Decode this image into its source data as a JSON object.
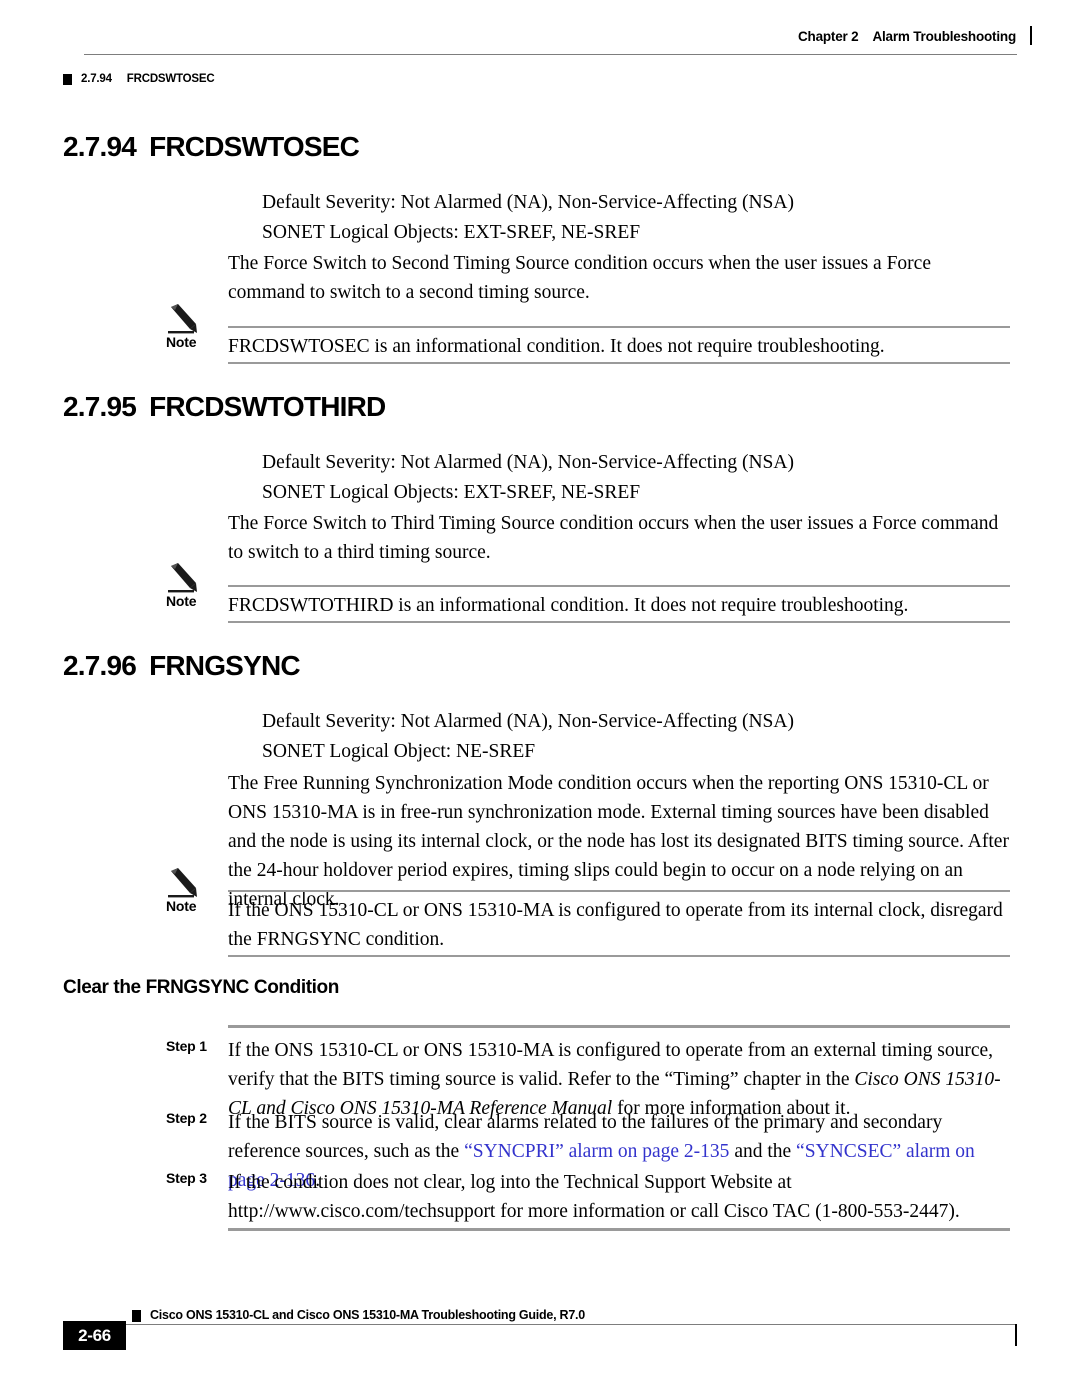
{
  "header": {
    "chapter": "Chapter 2",
    "running_head": "Alarm Troubleshooting",
    "section_number": "2.7.94",
    "section_title": "FRCDSWTOSEC"
  },
  "sections": [
    {
      "number": "2.7.94",
      "title": "FRCDSWTOSEC",
      "severity": "Default Severity: Not Alarmed (NA), Non-Service-Affecting (NSA)",
      "objects": "SONET Logical Objects: EXT-SREF, NE-SREF",
      "description": "The Force Switch to Second Timing Source condition occurs when the user issues a Force command to switch to a second timing source.",
      "note_label": "Note",
      "note_text": "FRCDSWTOSEC is an informational condition. It does not require troubleshooting."
    },
    {
      "number": "2.7.95",
      "title": "FRCDSWTOTHIRD",
      "severity": "Default Severity: Not Alarmed (NA), Non-Service-Affecting (NSA)",
      "objects": "SONET Logical Objects: EXT-SREF, NE-SREF",
      "description": "The Force Switch to Third Timing Source condition occurs when the user issues a Force command to switch to a third timing source.",
      "note_label": "Note",
      "note_text": "FRCDSWTOTHIRD is an informational condition. It does not require troubleshooting."
    },
    {
      "number": "2.7.96",
      "title": "FRNGSYNC",
      "severity": "Default Severity: Not Alarmed (NA), Non-Service-Affecting (NSA)",
      "objects": "SONET Logical Object: NE-SREF",
      "description": "The Free Running Synchronization Mode condition occurs when the reporting ONS 15310-CL or ONS 15310-MA is in free-run synchronization mode. External timing sources have been disabled and the node is using its internal clock, or the node has lost its designated BITS timing source. After the 24-hour holdover period expires, timing slips could begin to occur on a node relying on an internal clock.",
      "note_label": "Note",
      "note_text": "If the ONS 15310-CL or ONS 15310-MA is configured to operate from its internal clock, disregard the FRNGSYNC condition."
    }
  ],
  "procedure": {
    "heading": "Clear the FRNGSYNC Condition",
    "steps": [
      {
        "label": "Step 1",
        "text_a": "If the ONS 15310-CL or ONS 15310-MA is configured to operate from an external timing source, verify that the BITS timing source is valid. Refer to the “Timing” chapter in the ",
        "italic": "Cisco ONS 15310-CL and Cisco ONS 15310-MA Reference Manual",
        "text_b": " for more information about it."
      },
      {
        "label": "Step 2",
        "text_a": "If the BITS source is valid, clear alarms related to the failures of the primary and secondary reference sources, such as the ",
        "link_1": "“SYNCPRI” alarm on page 2-135",
        "text_b": " and the ",
        "link_2": "“SYNCSEC” alarm on page 2-136",
        "text_c": "."
      },
      {
        "label": "Step 3",
        "text_a": "If the condition does not clear, log into the Technical Support Website at http://www.cisco.com/techsupport for more information or call Cisco TAC (1-800-553-2447)."
      }
    ]
  },
  "footer": {
    "page_number": "2-66",
    "guide_title": "Cisco ONS 15310-CL and Cisco ONS 15310-MA Troubleshooting Guide, R7.0"
  },
  "colors": {
    "link": "#3333cc",
    "rule": "#9a9a9a",
    "thin_rule": "#7d7d7d"
  }
}
